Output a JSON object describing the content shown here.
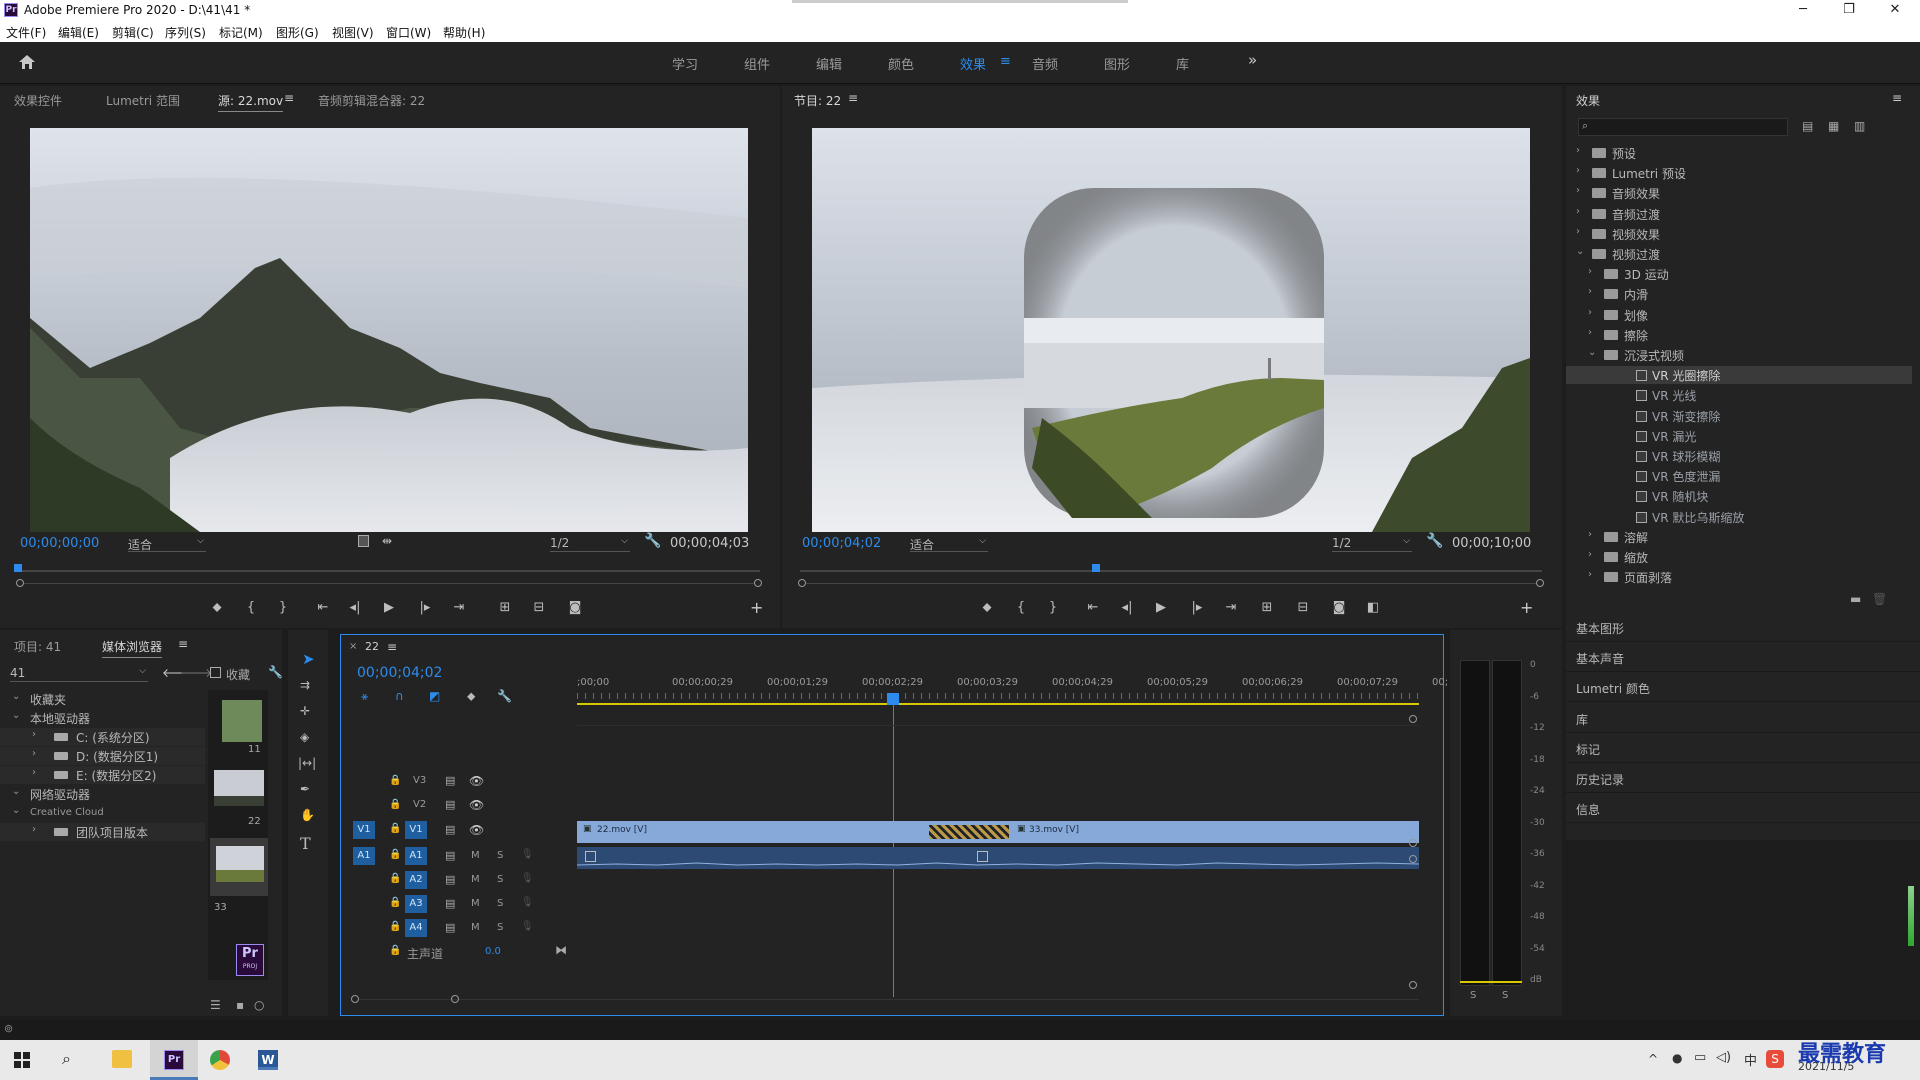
{
  "window": {
    "title": "Adobe Premiere Pro 2020 - D:\\41\\41 *",
    "logo": "Pr",
    "minimize": "─",
    "maximize": "❐",
    "close": "✕"
  },
  "menu": [
    "文件(F)",
    "编辑(E)",
    "剪辑(C)",
    "序列(S)",
    "标记(M)",
    "图形(G)",
    "视图(V)",
    "窗口(W)",
    "帮助(H)"
  ],
  "workspaces": {
    "items": [
      "学习",
      "组件",
      "编辑",
      "颜色",
      "效果",
      "音频",
      "图形",
      "库"
    ],
    "active": "效果",
    "more": "»"
  },
  "source_panel": {
    "tabs": [
      "效果控件",
      "Lumetri 范围",
      "源: 22.mov",
      "音频剪辑混合器: 22"
    ],
    "timecode": "00;00;00;00",
    "fit": "适合",
    "resolution": "1/2",
    "duration": "00;00;04;03"
  },
  "program_panel": {
    "tab": "节目: 22",
    "timecode": "00;00;04;02",
    "fit": "适合",
    "resolution": "1/2",
    "duration": "00;00;10;00"
  },
  "effects_panel": {
    "title": "效果",
    "search_placeholder": "",
    "tree": [
      {
        "label": "预设",
        "level": 0
      },
      {
        "label": "Lumetri 预设",
        "level": 0
      },
      {
        "label": "音频效果",
        "level": 0
      },
      {
        "label": "音频过渡",
        "level": 0
      },
      {
        "label": "视频效果",
        "level": 0
      },
      {
        "label": "视频过渡",
        "level": 0,
        "open": true
      },
      {
        "label": "3D 运动",
        "level": 1
      },
      {
        "label": "内滑",
        "level": 1
      },
      {
        "label": "划像",
        "level": 1
      },
      {
        "label": "擦除",
        "level": 1
      },
      {
        "label": "沉浸式视频",
        "level": 1,
        "open": true
      },
      {
        "label": "VR 光圈擦除",
        "level": 2,
        "selected": true
      },
      {
        "label": "VR 光线",
        "level": 2
      },
      {
        "label": "VR 渐变擦除",
        "level": 2
      },
      {
        "label": "VR 漏光",
        "level": 2
      },
      {
        "label": "VR 球形模糊",
        "level": 2
      },
      {
        "label": "VR 色度泄漏",
        "level": 2
      },
      {
        "label": "VR 随机块",
        "level": 2
      },
      {
        "label": "VR 默比乌斯缩放",
        "level": 2
      },
      {
        "label": "溶解",
        "level": 1
      },
      {
        "label": "缩放",
        "level": 1
      },
      {
        "label": "页面剥落",
        "level": 1
      }
    ],
    "sections": [
      "基本图形",
      "基本声音",
      "Lumetri 颜色",
      "库",
      "标记",
      "历史记录",
      "信息"
    ]
  },
  "project_panel": {
    "tabs": [
      "项目: 41",
      "媒体浏览器"
    ],
    "location": "41",
    "collect_label": "收藏",
    "tree": [
      {
        "label": "收藏夹",
        "level": 0
      },
      {
        "label": "本地驱动器",
        "level": 0
      },
      {
        "label": "C: (系统分区)",
        "level": 1
      },
      {
        "label": "D: (数据分区1)",
        "level": 1
      },
      {
        "label": "E: (数据分区2)",
        "level": 1
      },
      {
        "label": "网络驱动器",
        "level": 0
      },
      {
        "label": "Creative Cloud",
        "level": 0
      },
      {
        "label": "团队项目版本",
        "level": 1
      }
    ],
    "thumbs": [
      {
        "label": "11"
      },
      {
        "label": "22"
      },
      {
        "label": "33"
      }
    ],
    "proj_icon": "Pr",
    "proj_sub": "PROJ"
  },
  "timeline": {
    "tab": "22",
    "timecode": "00;00;04;02",
    "ruler": [
      ";00;00",
      "00;00;00;29",
      "00;00;01;29",
      "00;00;02;29",
      "00;00;03;29",
      "00;00;04;29",
      "00;00;05;29",
      "00;00;06;29",
      "00;00;07;29",
      "00;"
    ],
    "video_tracks": [
      "V3",
      "V2",
      "V1"
    ],
    "audio_tracks": [
      "A1",
      "A2",
      "A3",
      "A4"
    ],
    "master_label": "主声道",
    "master_value": "0.0",
    "clips": {
      "v1_a": "22.mov [V]",
      "v1_b": "33.mov [V]"
    },
    "m": "M",
    "s": "S"
  },
  "meter": {
    "labels": [
      "0",
      "-6",
      "-12",
      "-18",
      "-24",
      "-30",
      "-36",
      "-42",
      "-48",
      "-54",
      "dB"
    ],
    "solo": [
      "S",
      "S"
    ]
  },
  "taskbar": {
    "date": "2021/11/5",
    "watermark": "最需教育",
    "ime": "中"
  }
}
